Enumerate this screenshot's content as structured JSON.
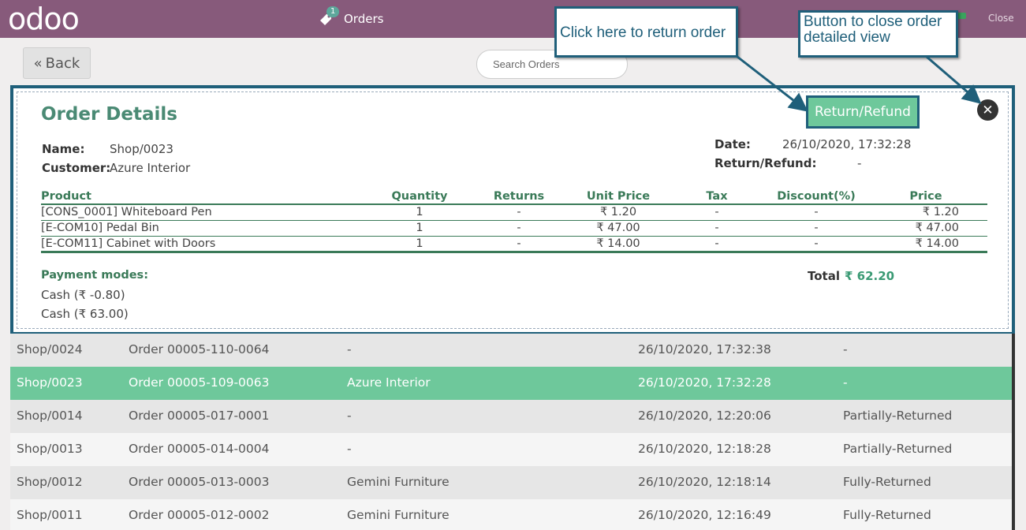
{
  "topbar": {
    "logo": "odoo",
    "orders_tab_label": "Orders",
    "orders_badge": "1",
    "close_label": "Close"
  },
  "toolbar": {
    "back_label": "Back",
    "search_placeholder": "Search Orders"
  },
  "detail": {
    "title": "Order Details",
    "name_label": "Name:",
    "name_value": "Shop/0023",
    "customer_label": "Customer:",
    "customer_value": "Azure Interior",
    "date_label": "Date:",
    "date_value": "26/10/2020, 17:32:28",
    "return_refund_label": "Return/Refund:",
    "return_refund_value": "-",
    "return_button": "Return/Refund",
    "close_icon": "close-icon",
    "columns": [
      "Product",
      "Quantity",
      "Returns",
      "Unit Price",
      "Tax",
      "Discount(%)",
      "Price"
    ],
    "lines": [
      [
        "[CONS_0001] Whiteboard Pen",
        "1",
        "-",
        "₹ 1.20",
        "-",
        "-",
        "₹ 1.20"
      ],
      [
        "[E-COM10] Pedal Bin",
        "1",
        "-",
        "₹ 47.00",
        "-",
        "-",
        "₹ 47.00"
      ],
      [
        "[E-COM11] Cabinet with Doors",
        "1",
        "-",
        "₹ 14.00",
        "-",
        "-",
        "₹ 14.00"
      ]
    ],
    "payment_modes_label": "Payment modes:",
    "payments": [
      "Cash (₹ -0.80)",
      "Cash (₹ 63.00)"
    ],
    "total_label": "Total",
    "total_value": "₹ 62.20"
  },
  "orders": [
    [
      "Shop/0024",
      "Order 00005-110-0064",
      "-",
      "26/10/2020, 17:32:38",
      "-"
    ],
    [
      "Shop/0023",
      "Order 00005-109-0063",
      "Azure Interior",
      "26/10/2020, 17:32:28",
      "-"
    ],
    [
      "Shop/0014",
      "Order 00005-017-0001",
      "-",
      "26/10/2020, 12:20:06",
      "Partially-Returned"
    ],
    [
      "Shop/0013",
      "Order 00005-014-0004",
      "-",
      "26/10/2020, 12:18:28",
      "Partially-Returned"
    ],
    [
      "Shop/0012",
      "Order 00005-013-0003",
      "Gemini Furniture",
      "26/10/2020, 12:18:14",
      "Fully-Returned"
    ],
    [
      "Shop/0011",
      "Order 00005-012-0002",
      "Gemini Furniture",
      "26/10/2020, 12:16:49",
      "Fully-Returned"
    ]
  ],
  "selected_order_index": 1,
  "annotations": {
    "return_callout": "Click here to return order",
    "close_callout": "Button to close order detailed view"
  },
  "colors": {
    "topbar": "#875a7b",
    "accent_green": "#6ec89b",
    "callout_border": "#1f5f7a"
  }
}
